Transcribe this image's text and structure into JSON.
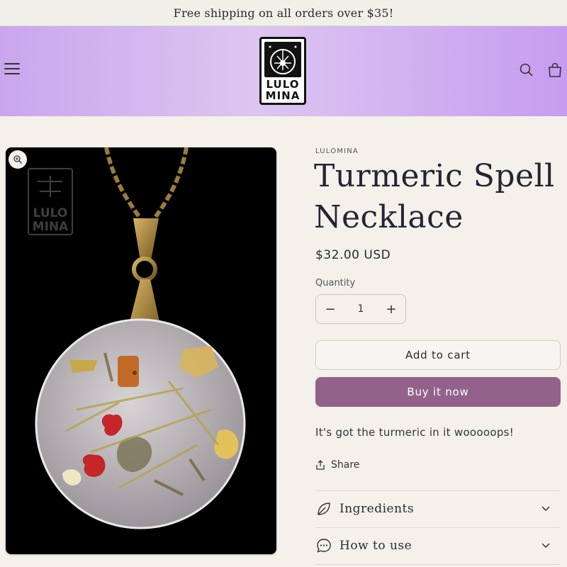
{
  "announcement": "Free shipping on all orders over $35!",
  "brand": {
    "logo_line1": "LULO",
    "logo_line2": "MINA"
  },
  "product": {
    "vendor": "LULOMINA",
    "title": "Turmeric Spell Necklace",
    "price": "$32.00 USD",
    "quantity_label": "Quantity",
    "quantity": "1",
    "decrease_symbol": "−",
    "increase_symbol": "+",
    "add_to_cart": "Add to cart",
    "buy_now": "Buy it now",
    "description": "It's got the turmeric in it wooooops!",
    "share": "Share",
    "image_watermark_line1": "LULO",
    "image_watermark_line2": "MINA"
  },
  "accordions": [
    {
      "label": "Ingredients",
      "icon": "leaf-icon"
    },
    {
      "label": "How to use",
      "icon": "chat-bubble-icon"
    }
  ],
  "colors": {
    "header_gradient": [
      "#caa6ee",
      "#c79cf0"
    ],
    "buy_button": "#93628b",
    "page_bg": "#f3f1ea"
  }
}
